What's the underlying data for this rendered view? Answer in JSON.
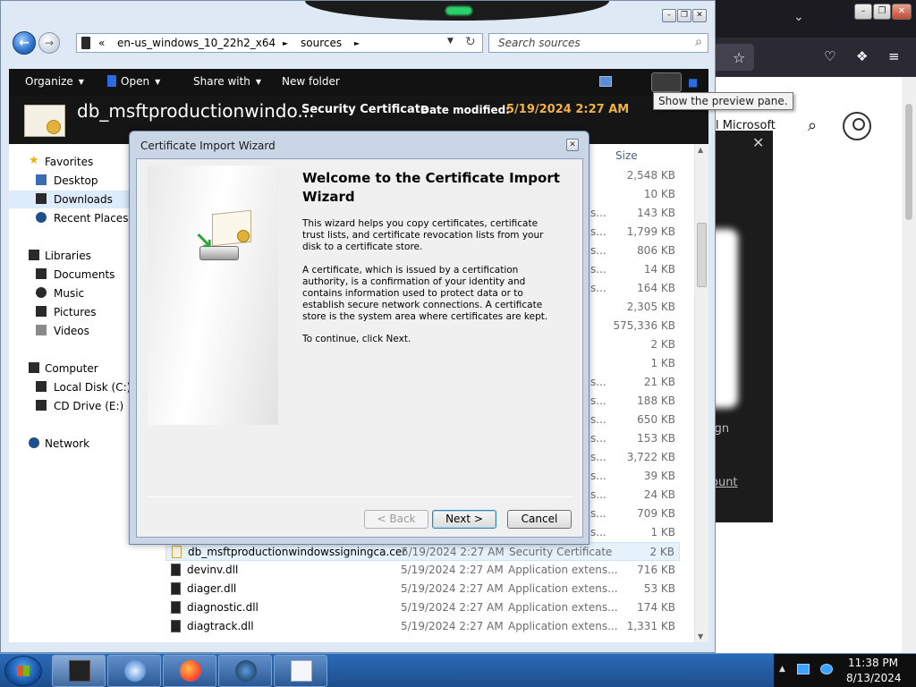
{
  "colors": {
    "explorer_frame": "#dfe9f5",
    "command_bar": "#121212",
    "details_accent": "#f1b23f",
    "selection": "#dcecfc",
    "taskbar": "#2b6ab8"
  },
  "browser": {
    "microsoft_text": "l Microsoft",
    "sign_text": "ign",
    "account_text": "ount"
  },
  "explorer": {
    "address": {
      "separator": "«",
      "segments": [
        "en-us_windows_10_22h2_x64",
        "sources"
      ],
      "arrow_glyph": "►"
    },
    "search": {
      "placeholder": "Search sources"
    },
    "command_bar": {
      "organize": "Organize",
      "open": "Open",
      "share_with": "Share with",
      "new_folder": "New folder"
    },
    "tooltip": "Show the preview pane.",
    "details": {
      "file_name": "db_msftproductionwindo...",
      "file_type": "Security Certificate",
      "date_label": "Date modified:",
      "date_value": "5/19/2024 2:27 AM"
    },
    "navigation": {
      "favorites": "Favorites",
      "desktop": "Desktop",
      "downloads": "Downloads",
      "recent_places": "Recent Places",
      "libraries": "Libraries",
      "documents": "Documents",
      "music": "Music",
      "pictures": "Pictures",
      "videos": "Videos",
      "computer": "Computer",
      "local_disk": "Local Disk (C:)",
      "cd_drive": "CD Drive (E:)",
      "network": "Network"
    },
    "columns": {
      "size": "Size"
    },
    "hidden_rows": [
      {
        "type_fragment": "",
        "size": "2,548 KB"
      },
      {
        "type_fragment": "",
        "size": "10 KB"
      },
      {
        "type_fragment": "s...",
        "size": "143 KB"
      },
      {
        "type_fragment": "s...",
        "size": "1,799 KB"
      },
      {
        "type_fragment": "s...",
        "size": "806 KB"
      },
      {
        "type_fragment": "s...",
        "size": "14 KB"
      },
      {
        "type_fragment": "s...",
        "size": "164 KB"
      },
      {
        "type_fragment": "",
        "size": "2,305 KB"
      },
      {
        "type_fragment": "",
        "size": "575,336 KB"
      },
      {
        "type_fragment": "",
        "size": "2 KB"
      },
      {
        "type_fragment": "",
        "size": "1 KB"
      },
      {
        "type_fragment": "s...",
        "size": "21 KB"
      },
      {
        "type_fragment": "s...",
        "size": "188 KB"
      },
      {
        "type_fragment": "s...",
        "size": "650 KB"
      },
      {
        "type_fragment": "s...",
        "size": "153 KB"
      },
      {
        "type_fragment": "s...",
        "size": "3,722 KB"
      },
      {
        "type_fragment": "s...",
        "size": "39 KB"
      },
      {
        "type_fragment": "s...",
        "size": "24 KB"
      },
      {
        "type_fragment": "s...",
        "size": "709 KB"
      },
      {
        "type_fragment": "s...",
        "size": "1 KB"
      }
    ],
    "visible_rows": [
      {
        "name": "db_msftproductionwindowssigningca.cer",
        "date": "5/19/2024 2:27 AM",
        "type": "Security Certificate",
        "size": "2 KB"
      },
      {
        "name": "devinv.dll",
        "date": "5/19/2024 2:27 AM",
        "type": "Application extens...",
        "size": "716 KB"
      },
      {
        "name": "diager.dll",
        "date": "5/19/2024 2:27 AM",
        "type": "Application extens...",
        "size": "53 KB"
      },
      {
        "name": "diagnostic.dll",
        "date": "5/19/2024 2:27 AM",
        "type": "Application extens...",
        "size": "174 KB"
      },
      {
        "name": "diagtrack.dll",
        "date": "5/19/2024 2:27 AM",
        "type": "Application extens...",
        "size": "1,331 KB"
      }
    ]
  },
  "wizard": {
    "title": "Certificate Import Wizard",
    "heading": "Welcome to the Certificate Import Wizard",
    "paragraph1": "This wizard helps you copy certificates, certificate trust lists, and certificate revocation lists from your disk to a certificate store.",
    "paragraph2": "A certificate, which is issued by a certification authority, is a confirmation of your identity and contains information used to protect data or to establish secure network connections. A certificate store is the system area where certificates are kept.",
    "paragraph3": "To continue, click Next.",
    "buttons": {
      "back": "< Back",
      "next": "Next >",
      "cancel": "Cancel"
    }
  },
  "taskbar": {
    "apps": [
      "explorer-app",
      "media-player-app",
      "firefox-app",
      "steam-app",
      "document-app"
    ],
    "time": "11:38 PM",
    "date": "8/13/2024"
  }
}
